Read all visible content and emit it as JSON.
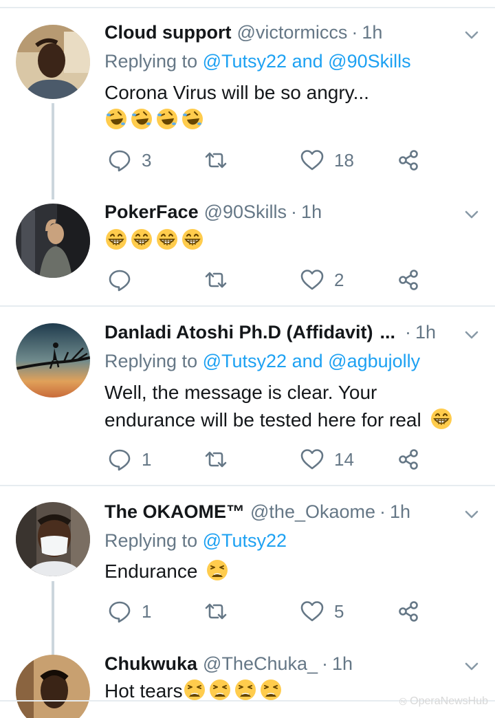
{
  "tweets": [
    {
      "name": "Cloud support",
      "handle": "@victormiccs",
      "time": "1h",
      "replying_prefix": "Replying to",
      "replying_users": [
        "@Tutsy22",
        "@90Skills"
      ],
      "replying_and": "and",
      "text": "Corona Virus will be so angry...",
      "emojis": [
        "rofl",
        "rofl",
        "rofl",
        "rofl"
      ],
      "replies": "3",
      "retweets": "",
      "likes": "18"
    },
    {
      "name": "PokerFace",
      "handle": "@90Skills",
      "time": "1h",
      "text": "",
      "emojis": [
        "grin",
        "grin",
        "grin",
        "grin"
      ],
      "replies": "",
      "retweets": "",
      "likes": "2"
    },
    {
      "name": "Danladi Atoshi Ph.D (Affidavit)",
      "name_truncation": "...",
      "time": "1h",
      "replying_prefix": "Replying to",
      "replying_users": [
        "@Tutsy22",
        "@agbujolly"
      ],
      "replying_and": "and",
      "text_line1": "Well, the message is clear. Your",
      "text_line2": "endurance will be tested here for real",
      "emojis": [
        "grin"
      ],
      "replies": "1",
      "retweets": "",
      "likes": "14"
    },
    {
      "name": "The OKAOME™",
      "handle": "@the_Okaome",
      "time": "1h",
      "replying_prefix": "Replying to",
      "replying_users": [
        "@Tutsy22"
      ],
      "text": "Endurance",
      "emojis": [
        "tired"
      ],
      "replies": "1",
      "retweets": "",
      "likes": "5"
    },
    {
      "name": "Chukwuka",
      "handle": "@TheChuka_",
      "time": "1h",
      "text": "Hot tears",
      "emojis": [
        "tired",
        "tired",
        "tired",
        "tired"
      ]
    }
  ],
  "separator_dot": "·",
  "watermark": "OperaNewsHub",
  "colors": {
    "link": "#1da1f2",
    "secondary": "#657786",
    "primary": "#14171a",
    "divider": "#e6ecf0",
    "thread": "#ccd6dd",
    "emoji": "#ffcc4d"
  },
  "icons": [
    "reply-icon",
    "retweet-icon",
    "like-icon",
    "share-icon",
    "chevron-down-icon"
  ]
}
